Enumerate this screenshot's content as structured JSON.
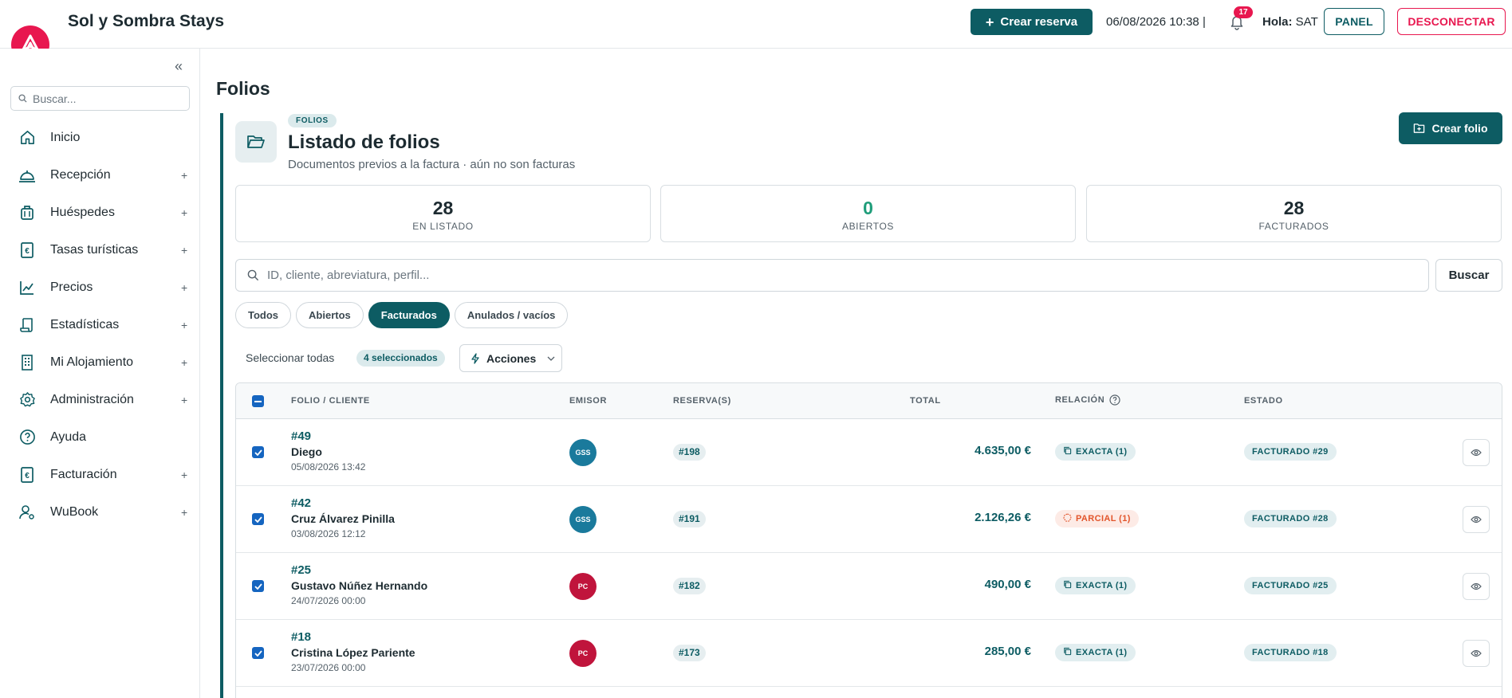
{
  "header": {
    "brand": "Sol y Sombra Stays",
    "create_reservation_label": "Crear reserva",
    "datetime": "06/08/2026 10:38 |",
    "notification_count": "17",
    "greeting_label": "Hola:",
    "user_name": "SAT",
    "panel_label": "PANEL",
    "logout_label": "DESCONECTAR"
  },
  "sidebar": {
    "search_placeholder": "Buscar...",
    "items": [
      {
        "label": "Inicio",
        "icon": "home-icon",
        "expandable": false
      },
      {
        "label": "Recepción",
        "icon": "bell-service-icon",
        "expandable": true
      },
      {
        "label": "Huéspedes",
        "icon": "luggage-icon",
        "expandable": true
      },
      {
        "label": "Tasas turísticas",
        "icon": "euro-doc-icon",
        "expandable": true
      },
      {
        "label": "Precios",
        "icon": "chart-line-icon",
        "expandable": true
      },
      {
        "label": "Estadísticas",
        "icon": "scroll-icon",
        "expandable": true
      },
      {
        "label": "Mi Alojamiento",
        "icon": "building-icon",
        "expandable": true
      },
      {
        "label": "Administración",
        "icon": "gear-icon",
        "expandable": true
      },
      {
        "label": "Ayuda",
        "icon": "help-icon",
        "expandable": false
      },
      {
        "label": "Facturación",
        "icon": "euro-doc-icon",
        "expandable": true
      },
      {
        "label": "WuBook",
        "icon": "user-settings-icon",
        "expandable": true
      }
    ],
    "expand_symbol": "+"
  },
  "main": {
    "page_title": "Folios",
    "chip": "FOLIOS",
    "list_title": "Listado de folios",
    "list_subtitle": "Documentos previos a la factura · aún no son facturas",
    "create_folio_label": "Crear folio",
    "stats": [
      {
        "value": "28",
        "label": "EN LISTADO"
      },
      {
        "value": "0",
        "label": "ABIERTOS"
      },
      {
        "value": "28",
        "label": "FACTURADOS"
      }
    ],
    "search_placeholder": "ID, cliente, abreviatura, perfil...",
    "search_button": "Buscar",
    "filters": [
      {
        "label": "Todos",
        "active": false
      },
      {
        "label": "Abiertos",
        "active": false
      },
      {
        "label": "Facturados",
        "active": true
      },
      {
        "label": "Anulados / vacíos",
        "active": false
      }
    ],
    "select_all_label": "Seleccionar todas",
    "selected_count": "4 seleccionados",
    "actions_label": "Acciones"
  },
  "table": {
    "headers": {
      "folio_client": "FOLIO / CLIENTE",
      "emitter": "EMISOR",
      "reservations": "RESERVA(S)",
      "total": "TOTAL",
      "relation": "RELACIÓN",
      "status": "ESTADO"
    },
    "rows": [
      {
        "id": "#49",
        "client": "Diego",
        "date": "05/08/2026 13:42",
        "emitter": "GSS",
        "emitter_color": "#1a7a9c",
        "reservation": "#198",
        "total": "4.635,00 €",
        "relation": "EXACTA (1)",
        "relation_type": "exacta",
        "status": "FACTURADO #29"
      },
      {
        "id": "#42",
        "client": "Cruz Álvarez Pinilla",
        "date": "03/08/2026 12:12",
        "emitter": "GSS",
        "emitter_color": "#1a7a9c",
        "reservation": "#191",
        "total": "2.126,26 €",
        "relation": "PARCIAL (1)",
        "relation_type": "parcial",
        "status": "FACTURADO #28"
      },
      {
        "id": "#25",
        "client": "Gustavo Núñez Hernando",
        "date": "24/07/2026 00:00",
        "emitter": "PC",
        "emitter_color": "#c0143c",
        "reservation": "#182",
        "total": "490,00 €",
        "relation": "EXACTA (1)",
        "relation_type": "exacta",
        "status": "FACTURADO #25"
      },
      {
        "id": "#18",
        "client": "Cristina López Pariente",
        "date": "23/07/2026 00:00",
        "emitter": "PC",
        "emitter_color": "#c0143c",
        "reservation": "#173",
        "total": "285,00 €",
        "relation": "EXACTA (1)",
        "relation_type": "exacta",
        "status": "FACTURADO #18"
      }
    ]
  },
  "colors": {
    "accent": "#0d5c63",
    "brand": "#e8174f",
    "checkbox": "#1565c0"
  }
}
